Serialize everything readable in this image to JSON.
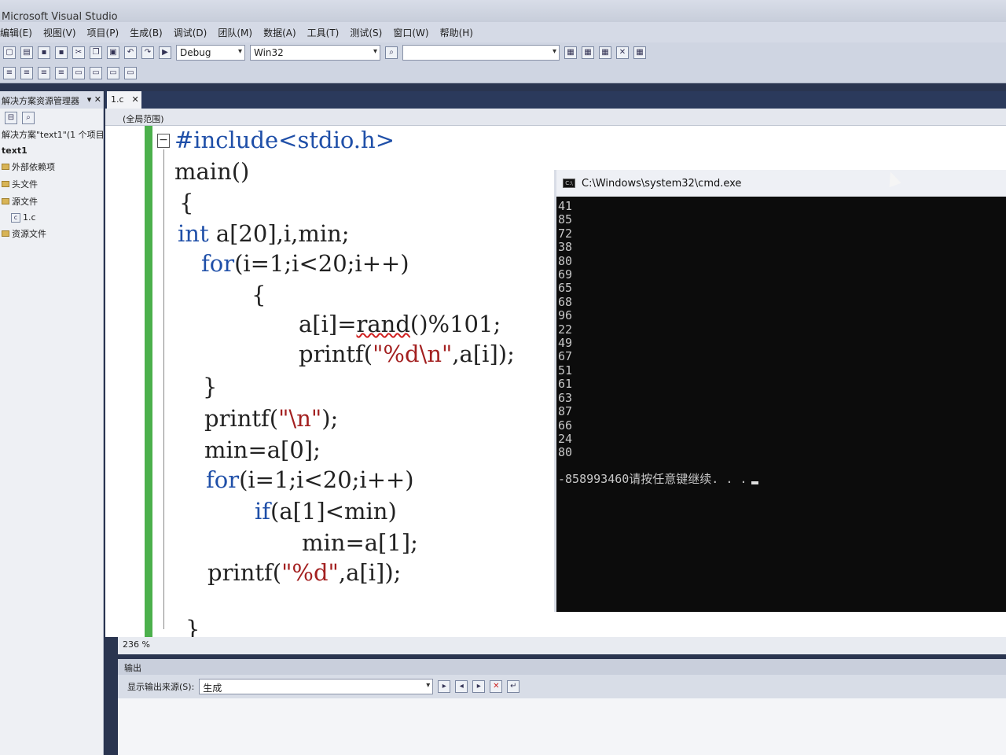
{
  "app": {
    "title": "Microsoft Visual Studio"
  },
  "menu": [
    "编辑(E)",
    "视图(V)",
    "项目(P)",
    "生成(B)",
    "调试(D)",
    "团队(M)",
    "数据(A)",
    "工具(T)",
    "测试(S)",
    "窗口(W)",
    "帮助(H)"
  ],
  "toolbar": {
    "config": "Debug",
    "platform": "Win32"
  },
  "solution_explorer": {
    "title": "解决方案资源管理器",
    "solution": "解决方案\"text1\"(1 个项目)",
    "project": "text1",
    "items": [
      {
        "label": "外部依赖项"
      },
      {
        "label": "头文件"
      },
      {
        "label": "源文件"
      },
      {
        "label": "1.c"
      },
      {
        "label": "资源文件"
      }
    ]
  },
  "editor": {
    "tab": "1.c",
    "scope": "(全局范围)",
    "zoom": "236 %",
    "lines": [
      "#include<stdio.h>",
      "main()",
      "{",
      "int a[20],i,min;",
      "for(i=1;i<20;i++)",
      "{",
      "a[i]=rand()%101;",
      "printf(\"%d\\n\",a[i]);",
      "}",
      "printf(\"\\n\");",
      "min=a[0];",
      "for(i=1;i<20;i++)",
      "if(a[1]<min)",
      "min=a[1];",
      "printf(\"%d\",a[i]);",
      "}"
    ]
  },
  "output": {
    "title": "输出",
    "source_label": "显示输出来源(S):",
    "source_value": "生成"
  },
  "cmd": {
    "title": "C:\\Windows\\system32\\cmd.exe",
    "numbers": [
      "41",
      "85",
      "72",
      "38",
      "80",
      "69",
      "65",
      "68",
      "96",
      "22",
      "49",
      "67",
      "51",
      "61",
      "63",
      "87",
      "66",
      "24",
      "80"
    ],
    "final": "-858993460请按任意键继续. . ."
  }
}
